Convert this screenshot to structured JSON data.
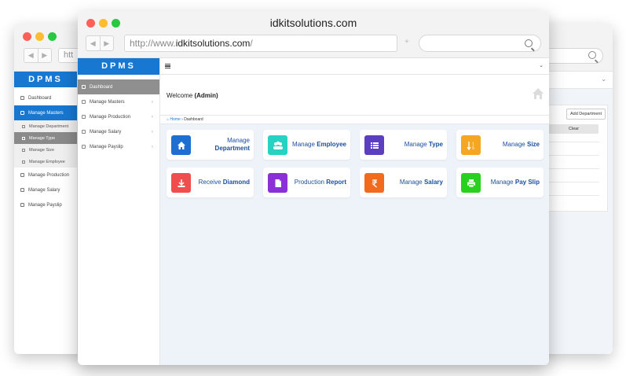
{
  "front": {
    "title": "idkitsolutions.com",
    "url_prefix": "http://www.",
    "url_domain": "idkitsolutions.com",
    "url_suffix": "/",
    "logo": "DPMS",
    "sidebar": [
      {
        "label": "Dashboard",
        "icon": "dashboard-icon",
        "active": true
      },
      {
        "label": "Manage Masters",
        "icon": "sitemap-icon"
      },
      {
        "label": "Manage Production",
        "icon": "gears-icon"
      },
      {
        "label": "Manage Salary",
        "icon": "money-icon"
      },
      {
        "label": "Manage Payslip",
        "icon": "edit-icon"
      }
    ],
    "welcome_prefix": "Welcome",
    "welcome_user": "(Admin)",
    "breadcrumb_home": "Home",
    "breadcrumb_sep": "›",
    "breadcrumb_current": "Dashboard",
    "cards": [
      {
        "pre": "Manage",
        "bold": "Department",
        "color": "#1d6fd1",
        "icon": "home-icon"
      },
      {
        "pre": "Manage",
        "bold": "Employee",
        "color": "#28d2c2",
        "icon": "users-icon"
      },
      {
        "pre": "Manage",
        "bold": "Type",
        "color": "#5b3fc0",
        "icon": "list-icon"
      },
      {
        "pre": "Manage",
        "bold": "Size",
        "color": "#f5a623",
        "icon": "sort-numeric-icon"
      },
      {
        "pre": "Receive",
        "bold": "Diamond",
        "color": "#ef4e4e",
        "icon": "download-icon"
      },
      {
        "pre": "Production",
        "bold": "Report",
        "color": "#8b2fd6",
        "icon": "file-icon"
      },
      {
        "pre": "Manage",
        "bold": "Salary",
        "color": "#f26b1d",
        "icon": "rupee-icon"
      },
      {
        "pre": "Manage",
        "bold": "Pay Slip",
        "color": "#2ad01e",
        "icon": "print-icon"
      }
    ]
  },
  "back": {
    "url_fragment": "htt",
    "logo": "DPMS",
    "sidebar": [
      {
        "label": "Dashboard",
        "type": "item"
      },
      {
        "label": "Manage Masters",
        "type": "item",
        "active": true
      },
      {
        "label": "Manage Department",
        "type": "sub"
      },
      {
        "label": "Manage Type",
        "type": "sub",
        "active": true
      },
      {
        "label": "Manage Size",
        "type": "sub"
      },
      {
        "label": "Manage Employee",
        "type": "sub"
      },
      {
        "label": "Manage Production",
        "type": "item"
      },
      {
        "label": "Manage Salary",
        "type": "item"
      },
      {
        "label": "Manage Payslip",
        "type": "item"
      }
    ],
    "add_button": "Add Department",
    "clear_button": "Clear"
  }
}
